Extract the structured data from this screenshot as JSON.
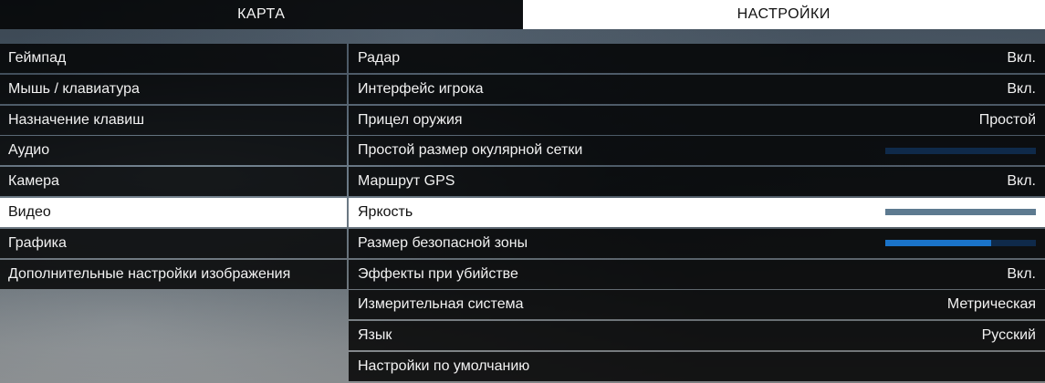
{
  "tabs": [
    {
      "label": "КАРТА",
      "active": false
    },
    {
      "label": "НАСТРОЙКИ",
      "active": true
    }
  ],
  "left_menu": {
    "items": [
      {
        "label": "Геймпад"
      },
      {
        "label": "Мышь / клавиатура"
      },
      {
        "label": "Назначение клавиш"
      },
      {
        "label": "Аудио"
      },
      {
        "label": "Камера"
      },
      {
        "label": "Видео",
        "selected": true
      },
      {
        "label": "Графика"
      },
      {
        "label": "Дополнительные настройки изображения"
      }
    ]
  },
  "settings": {
    "rows": [
      {
        "label": "Радар",
        "value": "Вкл."
      },
      {
        "label": "Интерфейс игрока",
        "value": "Вкл."
      },
      {
        "label": "Прицел оружия",
        "value": "Простой"
      },
      {
        "label": "Простой размер окулярной сетки",
        "slider": 0.0
      },
      {
        "label": "Маршрут GPS",
        "value": "Вкл."
      },
      {
        "label": "Яркость",
        "slider": 1.0,
        "selected": true
      },
      {
        "label": "Размер безопасной зоны",
        "slider": 0.7
      },
      {
        "label": "Эффекты при убийстве",
        "value": "Вкл."
      },
      {
        "label": "Измерительная система",
        "value": "Метрическая"
      },
      {
        "label": "Язык",
        "value": "Русский"
      },
      {
        "label": "Настройки по умолчанию"
      }
    ]
  },
  "colors": {
    "slider_track": "#0f2a4a",
    "slider_fill": "#1a73c8",
    "selected_slider": "#5d7a90"
  }
}
